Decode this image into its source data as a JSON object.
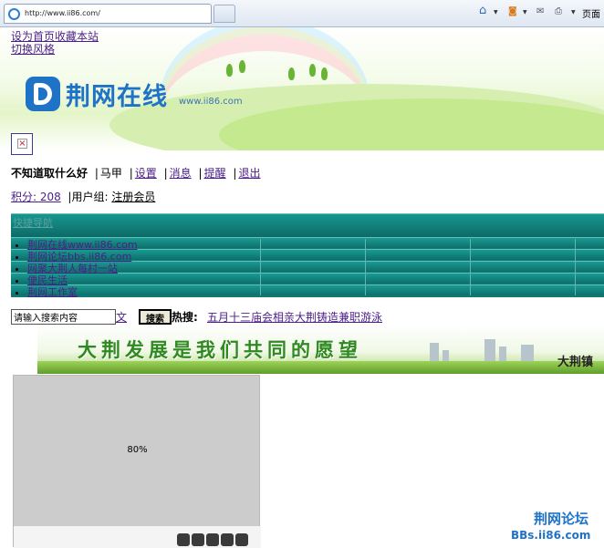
{
  "browser": {
    "url": "http://www.ii86.com/",
    "page_menu_label": "页面",
    "icons": [
      "ie-logo-icon",
      "home-icon",
      "feed-icon",
      "mail-icon",
      "print-icon"
    ]
  },
  "header": {
    "set_home_label": "设为首页收藏本站",
    "switch_style_label": "切换风格",
    "site_name": "荆网在线",
    "site_domain": "www.ii86.com"
  },
  "user": {
    "name": "不知道取什么好",
    "links": [
      "马甲",
      "设置",
      "消息",
      "提醒",
      "退出"
    ],
    "points_label": "积分: 208",
    "group_label": "用户组: ",
    "group_value": "注册会员"
  },
  "nav": {
    "title": "快捷导航",
    "items": [
      "荆网在线www.ii86.com",
      "荆网论坛bbs.ii86.com",
      "网聚大荆人每村一站",
      "便民生活",
      "荆网工作室"
    ]
  },
  "search": {
    "placeholder": "请输入搜索内容",
    "type_label": "文章",
    "button_label": "搜索",
    "hot_label": "热搜:",
    "hot_item": "五月十三庙会相亲大荆铸造兼职游泳"
  },
  "slogan_banner": {
    "text": "大荆发展是我们共同的愿望",
    "right_text": "大荆镇"
  },
  "slideshow": {
    "loading_text": "80%",
    "progress": 0.8,
    "dot_count": 5
  },
  "watermark": {
    "line1": "荆网论坛",
    "line2": "BBs.ii86.com"
  },
  "colors": {
    "brand_blue": "#1f73c7",
    "nav_teal": "#0e7a76",
    "link_purple": "#4b1f86"
  }
}
